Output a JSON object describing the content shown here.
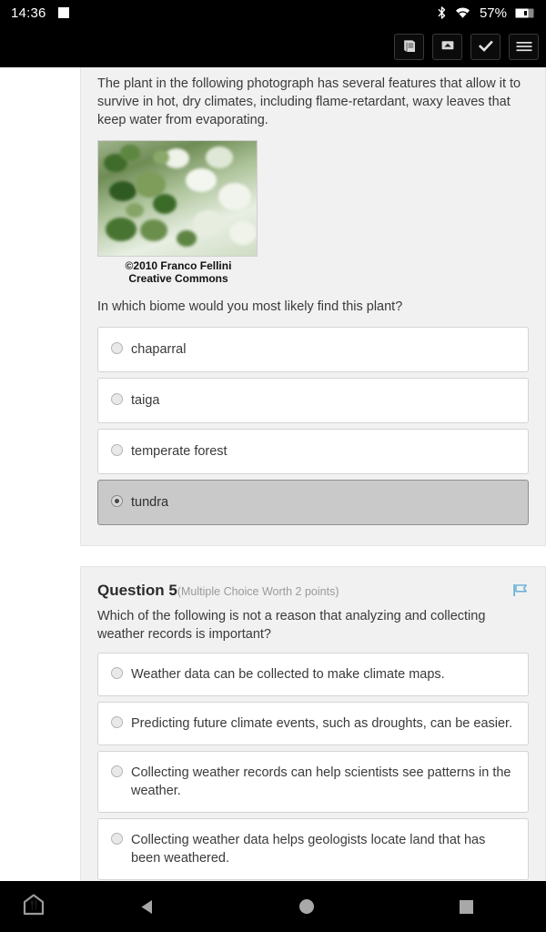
{
  "status_bar": {
    "time": "14:36",
    "battery_percent": "57%",
    "icons": [
      "stop-indicator-icon",
      "bluetooth-icon",
      "wifi-icon",
      "battery-icon"
    ]
  },
  "app_toolbar": {
    "buttons": [
      {
        "name": "book-icon",
        "label": "Book"
      },
      {
        "name": "inbox-icon",
        "label": "Inbox"
      },
      {
        "name": "check-icon",
        "label": "Check"
      },
      {
        "name": "menu-icon",
        "label": "Menu"
      }
    ]
  },
  "question_4": {
    "stem": "The plant in the following photograph has several features that allow it to survive in hot, dry climates, including flame-retardant, waxy leaves that keep water from evaporating.",
    "figure": {
      "alt": "Close-up photograph of a shrub with small green leaves and clusters of small white flowers",
      "caption_line_1": "©2010 Franco Fellini",
      "caption_line_2": "Creative Commons"
    },
    "prompt": "In which biome would you most likely find this plant?",
    "options": [
      {
        "label": "chaparral",
        "selected": false
      },
      {
        "label": "taiga",
        "selected": false
      },
      {
        "label": "temperate forest",
        "selected": false
      },
      {
        "label": "tundra",
        "selected": true
      }
    ]
  },
  "question_5": {
    "number_label": "Question 5",
    "meta": "(Multiple Choice Worth 2 points)",
    "flag_icon": "flag-icon",
    "flag_color": "#6fb3d6",
    "stem": "Which of the following is not a reason that analyzing and collecting weather records is important?",
    "options": [
      {
        "label": "Weather data can be collected to make climate maps.",
        "selected": false
      },
      {
        "label": "Predicting future climate events, such as droughts, can be easier.",
        "selected": false
      },
      {
        "label": "Collecting weather records can help scientists see patterns in the weather.",
        "selected": false
      },
      {
        "label": "Collecting weather data helps geologists locate land that has been weathered.",
        "selected": false
      }
    ]
  },
  "nav_bar": {
    "items": [
      {
        "name": "home-badge-icon",
        "label": "Home"
      },
      {
        "name": "back-icon",
        "label": "Back"
      },
      {
        "name": "home-circle-icon",
        "label": "Home"
      },
      {
        "name": "recents-square-icon",
        "label": "Recents"
      }
    ]
  },
  "colors": {
    "card_bg": "#f1f1f1",
    "page_bg": "#ffffff",
    "selected_option_bg": "#c9c9c9",
    "accent_flag": "#6fb3d6",
    "bar_bg": "#000000"
  }
}
